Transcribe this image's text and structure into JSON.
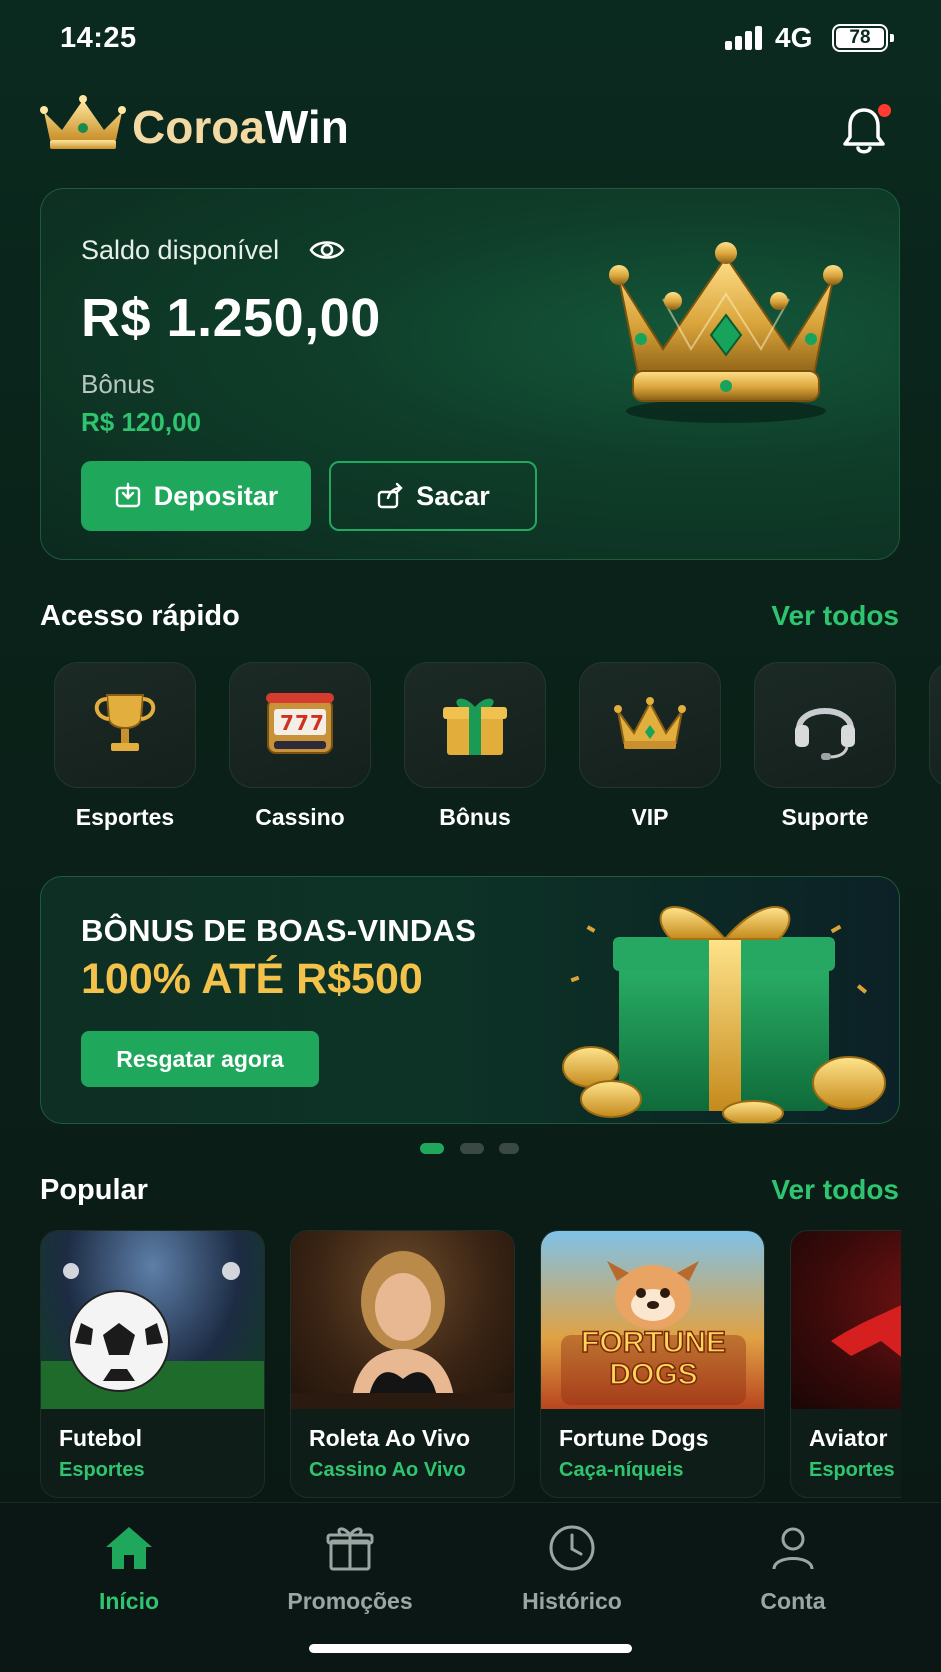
{
  "status_bar": {
    "time": "14:25",
    "network": "4G",
    "battery": "78"
  },
  "header": {
    "brand_part1": "Coroa",
    "brand_part2": "Win"
  },
  "balance": {
    "label": "Saldo disponível",
    "value": "R$ 1.250,00",
    "bonus_label": "Bônus",
    "bonus_value": "R$ 120,00",
    "deposit_label": "Depositar",
    "withdraw_label": "Sacar"
  },
  "quick_access": {
    "title": "Acesso rápido",
    "see_all": "Ver todos",
    "items": [
      {
        "label": "Esportes",
        "icon": "trophy-icon"
      },
      {
        "label": "Cassino",
        "icon": "slot-machine-icon"
      },
      {
        "label": "Bônus",
        "icon": "gift-icon"
      },
      {
        "label": "VIP",
        "icon": "crown-icon"
      },
      {
        "label": "Suporte",
        "icon": "headset-icon"
      }
    ]
  },
  "promo": {
    "line1": "BÔNUS DE BOAS-VINDAS",
    "line2": "100% ATÉ R$500",
    "button": "Resgatar agora",
    "slides": 3,
    "active_slide": 1
  },
  "popular": {
    "title": "Popular",
    "see_all": "Ver todos",
    "games": [
      {
        "name": "Futebol",
        "category": "Esportes"
      },
      {
        "name": "Roleta Ao Vivo",
        "category": "Cassino Ao Vivo"
      },
      {
        "name": "Fortune Dogs",
        "category": "Caça-níqueis",
        "thumb_text_1": "FORTUNE",
        "thumb_text_2": "DOGS"
      },
      {
        "name": "Aviator",
        "category": "Esportes"
      }
    ]
  },
  "bottom_nav": [
    {
      "label": "Início",
      "icon": "home-icon",
      "active": true
    },
    {
      "label": "Promoções",
      "icon": "gift-icon",
      "active": false
    },
    {
      "label": "Histórico",
      "icon": "clock-icon",
      "active": false
    },
    {
      "label": "Conta",
      "icon": "user-icon",
      "active": false
    }
  ],
  "colors": {
    "accent": "#1fa85c",
    "accent_text": "#2fc46f",
    "gold": "#f2c24b"
  }
}
